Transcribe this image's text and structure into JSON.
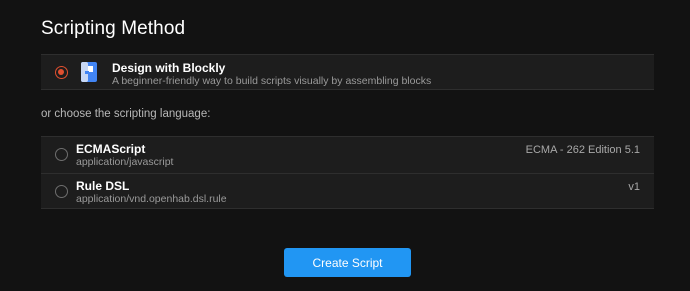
{
  "header": {
    "title": "Scripting Method"
  },
  "blockly": {
    "title": "Design with Blockly",
    "subtitle": "A beginner-friendly way to build scripts visually by assembling blocks",
    "selected": true,
    "icon": "blockly-icon"
  },
  "choose_label": "or choose the scripting language:",
  "languages": [
    {
      "title": "ECMAScript",
      "mime": "application/javascript",
      "version": "ECMA - 262 Edition 5.1",
      "selected": false
    },
    {
      "title": "Rule DSL",
      "mime": "application/vnd.openhab.dsl.rule",
      "version": "v1",
      "selected": false
    }
  ],
  "actions": {
    "create_label": "Create Script"
  },
  "colors": {
    "accent": "#2196f3",
    "radio_selected": "#e04f2f",
    "background": "#121212",
    "card": "#1d1d1d"
  }
}
